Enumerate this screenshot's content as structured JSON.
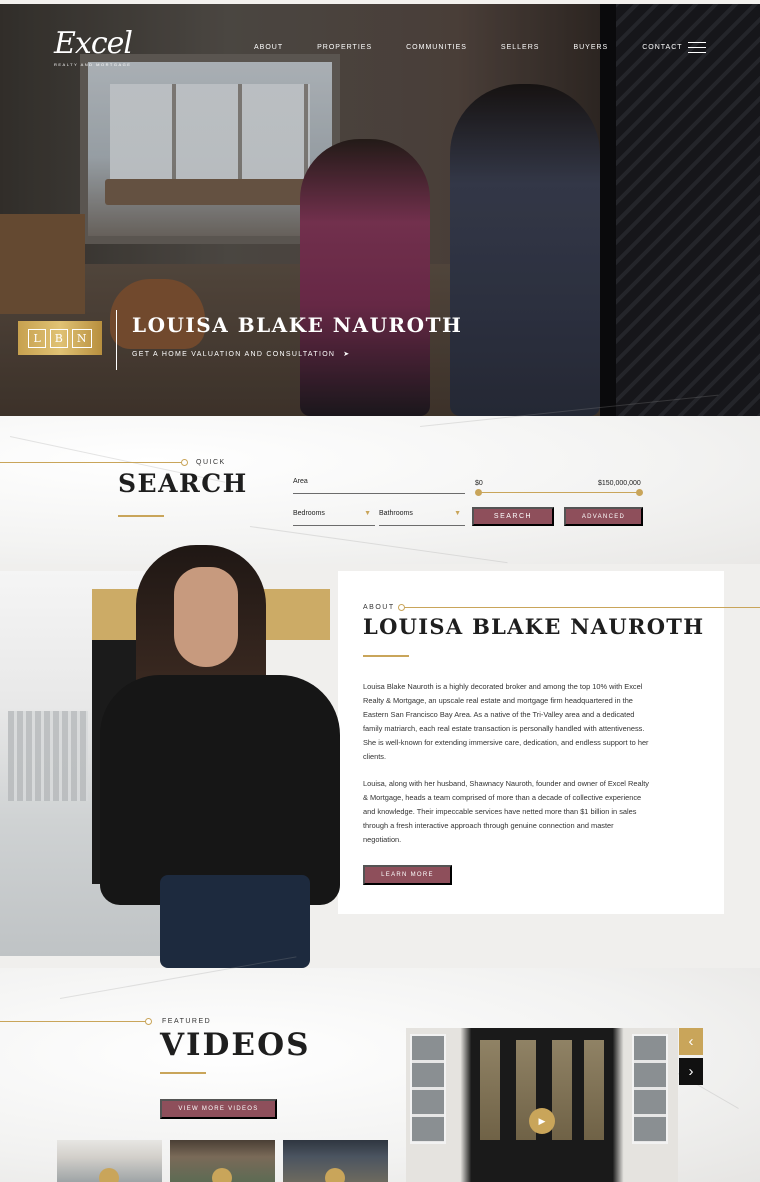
{
  "brand": {
    "logo_text": "Excel",
    "logo_tagline": "REALTY AND MORTGAGE"
  },
  "nav": {
    "items": [
      "ABOUT",
      "PROPERTIES",
      "COMMUNITIES",
      "SELLERS",
      "BUYERS",
      "CONTACT"
    ]
  },
  "hero": {
    "badge_letters": [
      "L",
      "B",
      "N"
    ],
    "name": "LOUISA BLAKE NAUROTH",
    "cta": "GET A HOME VALUATION AND CONSULTATION",
    "cta_arrow": "➤"
  },
  "search": {
    "kicker": "QUICK",
    "title": "SEARCH",
    "area_label": "Area",
    "price_min": "$0",
    "price_max": "$150,000,000",
    "bedrooms_label": "Bedrooms",
    "bathrooms_label": "Bathrooms",
    "search_button": "SEARCH",
    "advanced_button": "ADVANCED"
  },
  "about": {
    "kicker": "ABOUT",
    "title": "LOUISA BLAKE NAUROTH",
    "paragraph_1": "Louisa Blake Nauroth is a highly decorated broker and among the top 10% with Excel Realty & Mortgage, an upscale real estate and mortgage firm headquartered in the Eastern San Francisco Bay Area. As a native of the Tri-Valley area and a dedicated family matriarch, each real estate transaction is personally handled with attentiveness. She is well-known for extending immersive care, dedication, and endless support to her clients.",
    "paragraph_2": "Louisa, along with her husband, Shawnacy Nauroth, founder and owner of Excel Realty & Mortgage, heads a team comprised of more than a decade of collective experience and knowledge. Their impeccable services have netted more than $1 billion in sales through a fresh interactive approach through genuine connection and master negotiation.",
    "button": "LEARN MORE"
  },
  "videos": {
    "kicker": "FEATURED",
    "title": "VIDEOS",
    "button": "VIEW MORE VIDEOS",
    "prev_arrow": "‹",
    "next_arrow": "›",
    "play_glyph": "▶"
  },
  "colors": {
    "accent_gold": "#c9a55a",
    "button_mauve": "#8e4f5b",
    "text_dark": "#1e1e1e"
  }
}
